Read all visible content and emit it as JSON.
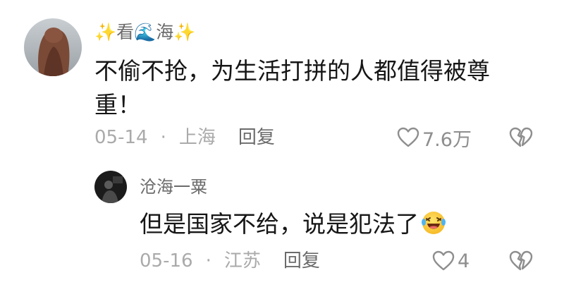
{
  "comments": [
    {
      "username": "✨看🌊海✨",
      "text": "不偷不抢，为生活打拼的人都值得被尊重！",
      "date": "05-14",
      "location": "上海",
      "reply_label": "回复",
      "likes": "7.6万"
    },
    {
      "username": "沧海一粟",
      "text": "但是国家不给，说是犯法了",
      "date": "05-16",
      "location": "江苏",
      "reply_label": "回复",
      "likes": "4"
    }
  ],
  "icons": {
    "like": "heart-outline-icon",
    "dislike": "broken-heart-icon",
    "reply_emoji": "laughing-tears-emoji"
  },
  "colors": {
    "text": "#161616",
    "secondary": "#6b6b6b",
    "meta": "#aaaaaa",
    "icon": "#8e8e8e"
  }
}
